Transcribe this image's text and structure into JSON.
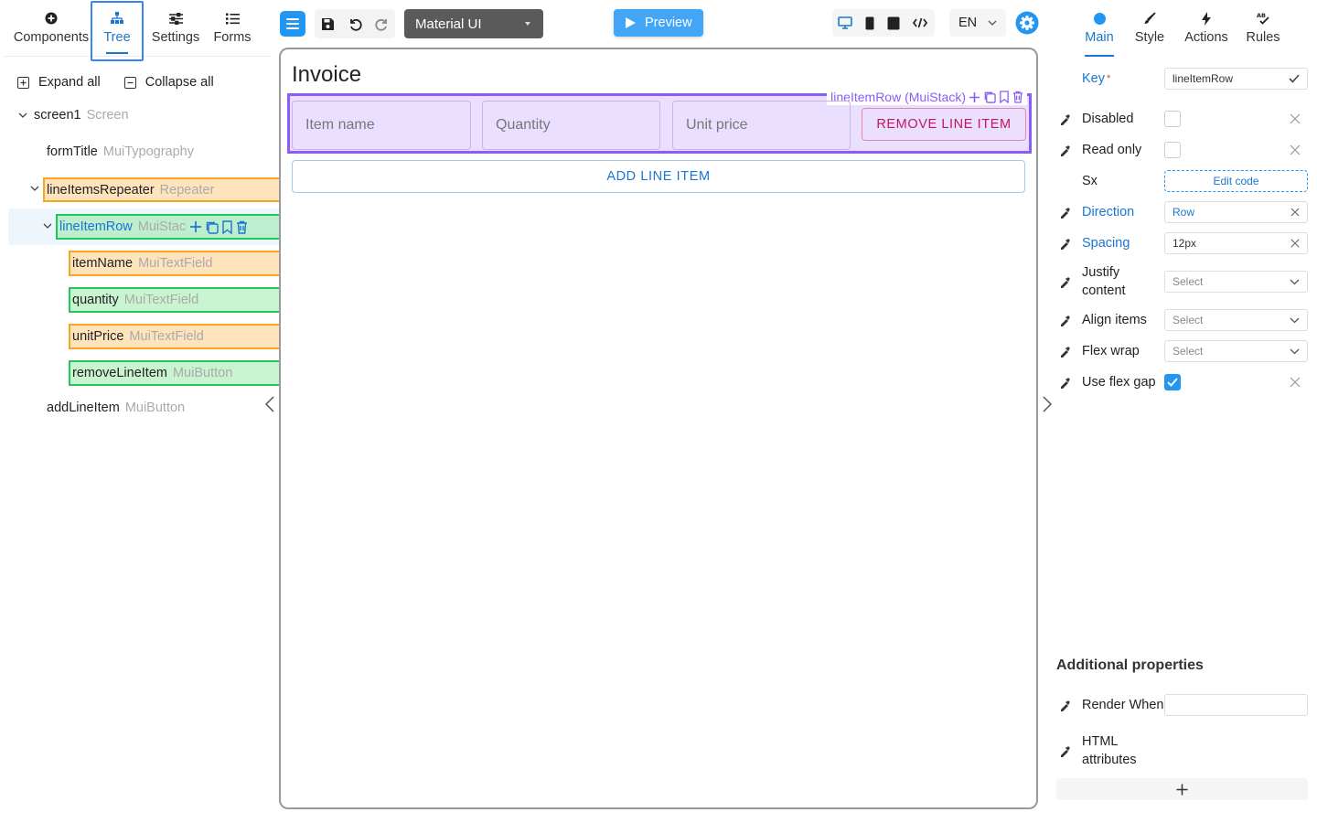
{
  "left_panel": {
    "tabs": [
      {
        "label": "Components",
        "icon": "plus-circle-icon"
      },
      {
        "label": "Tree",
        "icon": "hierarchy-icon",
        "active": true
      },
      {
        "label": "Settings",
        "icon": "sliders-icon"
      },
      {
        "label": "Forms",
        "icon": "list-icon"
      }
    ],
    "expand_all": "Expand all",
    "collapse_all": "Collapse all",
    "tree": [
      {
        "name": "screen1",
        "type": "Screen"
      },
      {
        "name": "formTitle",
        "type": "MuiTypography"
      },
      {
        "name": "lineItemsRepeater",
        "type": "Repeater"
      },
      {
        "name": "lineItemRow",
        "type": "MuiStac"
      },
      {
        "name": "itemName",
        "type": "MuiTextField"
      },
      {
        "name": "quantity",
        "type": "MuiTextField"
      },
      {
        "name": "unitPrice",
        "type": "MuiTextField"
      },
      {
        "name": "removeLineItem",
        "type": "MuiButton"
      },
      {
        "name": "addLineItem",
        "type": "MuiButton"
      }
    ]
  },
  "toolbar": {
    "ui_library": "Material UI",
    "preview": "Preview",
    "language": "EN",
    "accent": "#2196f3"
  },
  "canvas": {
    "title": "Invoice",
    "selected_label": "lineItemRow (MuiStack)",
    "fields": [
      "Item name",
      "Quantity",
      "Unit price"
    ],
    "remove_button": "REMOVE LINE ITEM",
    "add_button": "ADD LINE ITEM"
  },
  "right_panel": {
    "tabs": [
      {
        "label": "Main",
        "icon": "circle-icon",
        "active": true
      },
      {
        "label": "Style",
        "icon": "brush-icon"
      },
      {
        "label": "Actions",
        "icon": "lightning-icon"
      },
      {
        "label": "Rules",
        "icon": "rules-icon"
      }
    ],
    "key_label": "Key",
    "key_required": "*",
    "key_value": "lineItemRow",
    "props": {
      "disabled": "Disabled",
      "read_only": "Read only",
      "sx": "Sx",
      "sx_button": "Edit code",
      "direction": "Direction",
      "direction_value": "Row",
      "spacing": "Spacing",
      "spacing_value": "12px",
      "justify": "Justify content",
      "justify_value": "Select",
      "align": "Align items",
      "align_value": "Select",
      "wrap": "Flex wrap",
      "wrap_value": "Select",
      "gap": "Use flex gap",
      "gap_checked": true
    },
    "additional_title": "Additional properties",
    "render_when": "Render When",
    "html_attributes": "HTML attributes"
  }
}
